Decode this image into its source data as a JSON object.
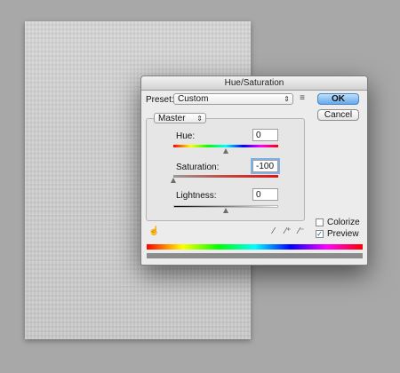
{
  "dialog": {
    "title": "Hue/Saturation",
    "preset_label": "Preset:",
    "preset_value": "Custom",
    "ok_label": "OK",
    "cancel_label": "Cancel",
    "channel_value": "Master",
    "hue": {
      "label": "Hue:",
      "value": "0",
      "level": 0.5
    },
    "saturation": {
      "label": "Saturation:",
      "value": "-100",
      "level": 0.0
    },
    "lightness": {
      "label": "Lightness:",
      "value": "0",
      "level": 0.5
    },
    "colorize": {
      "label": "Colorize",
      "checked": false
    },
    "preview": {
      "label": "Preview",
      "checked": true
    },
    "icons": {
      "preset_options": "list-options-icon",
      "on_image_adjust": "hand-adjust-icon",
      "eyedropper": "eyedropper-icon",
      "eyedropper_add": "eyedropper-plus-icon",
      "eyedropper_subtract": "eyedropper-minus-icon"
    }
  },
  "colors": {
    "accent": "#64a9ea",
    "background": "#a8a8a8",
    "dialog_bg": "#ececec"
  }
}
